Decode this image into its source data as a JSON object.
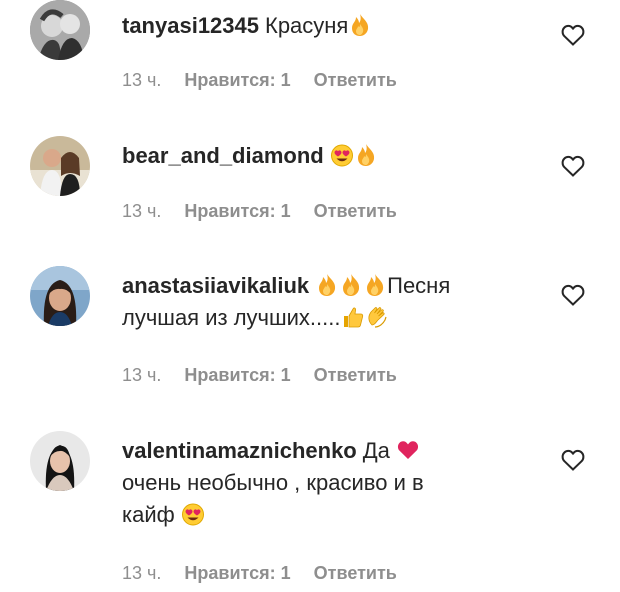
{
  "comments": [
    {
      "username": "tanyasi12345",
      "lines": [
        "Красуня"
      ],
      "emojis": [
        "fire-emoji"
      ],
      "time": "13 ч.",
      "likes": "Нравится: 1",
      "reply": "Ответить"
    },
    {
      "username": "bear_and_diamond",
      "lines": [
        ""
      ],
      "emojis": [
        "heart-eyes-emoji",
        "fire-emoji"
      ],
      "time": "13 ч.",
      "likes": "Нравится: 1",
      "reply": "Ответить"
    },
    {
      "username": "anastasiiavikaliuk",
      "lines": [
        "Песня",
        "лучшая из лучших....."
      ],
      "emojis": [
        "fire-emoji",
        "fire-emoji",
        "fire-emoji",
        "thumbs-up-emoji",
        "clapping-hands-emoji"
      ],
      "time": "13 ч.",
      "likes": "Нравится: 1",
      "reply": "Ответить"
    },
    {
      "username": "valentinamaznichenko",
      "lines": [
        "Да",
        "очень необычно , красиво и в",
        "кайф"
      ],
      "emojis": [
        "red-heart-emoji",
        "heart-eyes-emoji"
      ],
      "time": "13 ч.",
      "likes": "Нравится: 1",
      "reply": "Ответить"
    }
  ],
  "colors": {
    "text": "#262626",
    "meta": "#8e8e8e",
    "fire": "#f5a623",
    "heart": "#e0245e"
  },
  "icons": {
    "like_button": "heart-outline-icon"
  }
}
